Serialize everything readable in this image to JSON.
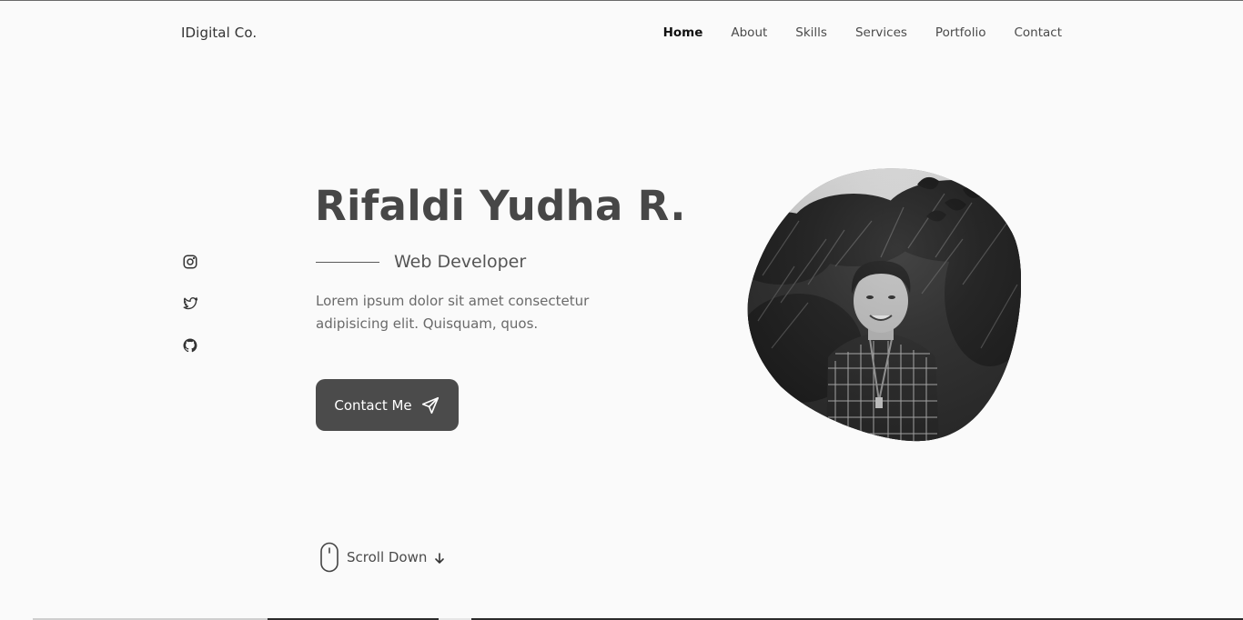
{
  "header": {
    "logo": "IDigital Co.",
    "nav": [
      {
        "label": "Home",
        "active": true
      },
      {
        "label": "About",
        "active": false
      },
      {
        "label": "Skills",
        "active": false
      },
      {
        "label": "Services",
        "active": false
      },
      {
        "label": "Portfolio",
        "active": false
      },
      {
        "label": "Contact",
        "active": false
      }
    ]
  },
  "social": {
    "items": [
      "instagram-icon",
      "twitter-icon",
      "github-icon"
    ]
  },
  "hero": {
    "name": "Rifaldi Yudha R.",
    "subtitle": "Web Developer",
    "description": "Lorem ipsum dolor sit amet consectetur adipisicing elit. Quisquam, quos.",
    "button_label": "Contact Me",
    "button_icon": "send-icon"
  },
  "photo": {
    "subject": "profile-photo"
  },
  "scroll": {
    "label": "Scroll Down",
    "icons": [
      "mouse-icon",
      "arrow-down-icon"
    ]
  },
  "colors": {
    "background": "#fafafa",
    "primary": "#4b4b4b",
    "text": "#4a4a4a",
    "heading": "#474747"
  }
}
